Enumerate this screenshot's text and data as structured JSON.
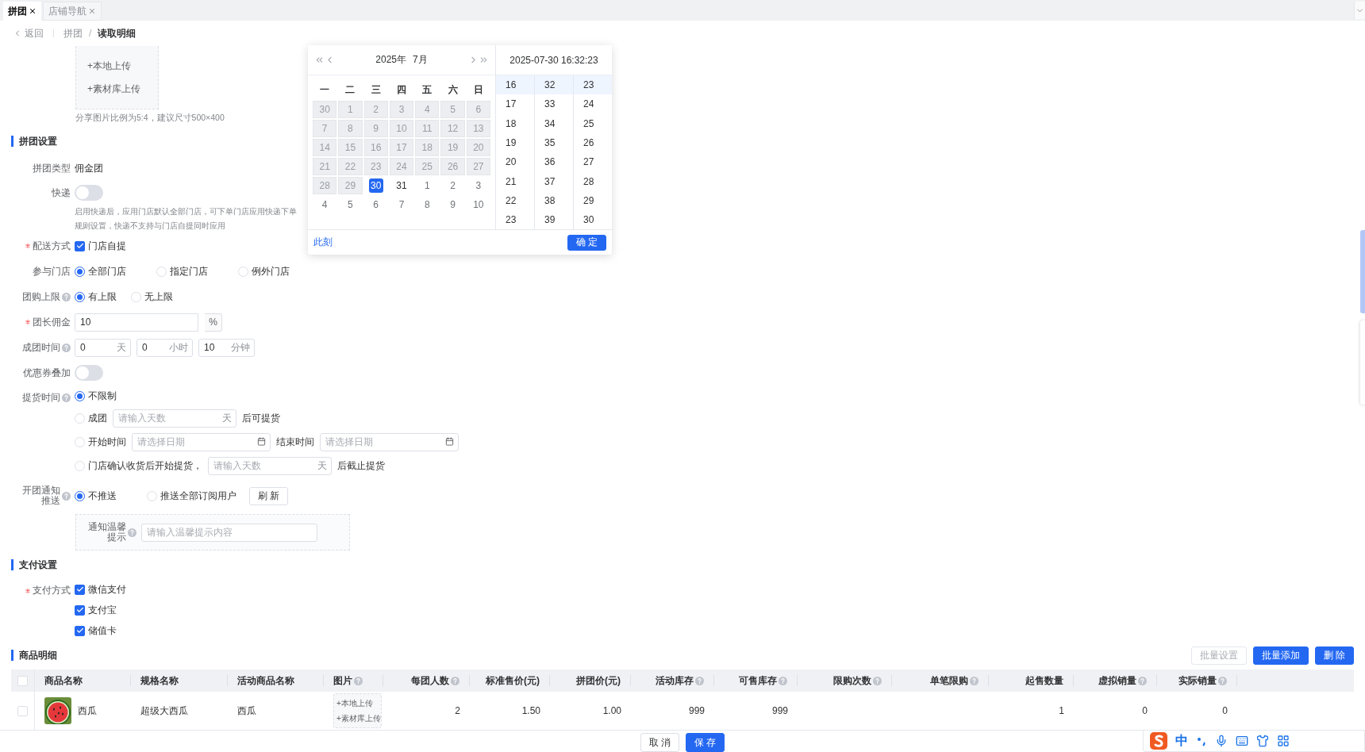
{
  "tabs": [
    {
      "label": "拼团",
      "selected": true
    },
    {
      "label": "店铺导航",
      "selected": false
    }
  ],
  "breadcrumb": {
    "back": "返回",
    "items": [
      "拼团",
      "读取明细"
    ],
    "separator": "/"
  },
  "share_image": {
    "upload_local": "+本地上传",
    "upload_library": "+素材库上传",
    "hint": "分享图片比例为5:4，建议尺寸500×400"
  },
  "group_settings": {
    "title": "拼团设置",
    "group_type": {
      "label": "拼团类型",
      "value": "佣金团"
    },
    "express": {
      "label": "快递",
      "on": false,
      "hint_lines": [
        "启用快递后，应用门店默认全部门店，可下单门店应用快递下单",
        "规则设置，快递不支持与门店自提同时应用"
      ]
    },
    "delivery": {
      "label": "配送方式",
      "required": true,
      "options": [
        {
          "label": "门店自提",
          "checked": true
        }
      ]
    },
    "stores": {
      "label": "参与门店",
      "options": [
        {
          "label": "全部门店",
          "selected": true
        },
        {
          "label": "指定门店",
          "selected": false
        },
        {
          "label": "例外门店",
          "selected": false
        }
      ]
    },
    "purchase_limit": {
      "label": "团购上限",
      "help": true,
      "options": [
        {
          "label": "有上限",
          "selected": true
        },
        {
          "label": "无上限",
          "selected": false
        }
      ]
    },
    "commission": {
      "label": "团长佣金",
      "required": true,
      "value": "10",
      "suffix": "%"
    },
    "duration": {
      "label": "成团时间",
      "help": true,
      "fields": [
        {
          "value": "0",
          "suffix": "天"
        },
        {
          "value": "0",
          "suffix": "小时"
        },
        {
          "value": "10",
          "suffix": "分钟"
        }
      ]
    },
    "coupon_stacking": {
      "label": "优惠券叠加",
      "on": false
    },
    "pickup_time": {
      "label": "提货时间",
      "help": true,
      "options": [
        {
          "kind": "plain",
          "label": "不限制",
          "selected": true
        },
        {
          "kind": "days",
          "label": "成团",
          "placeholder": "请输入天数",
          "suffix": "天",
          "after": "后可提货",
          "selected": false
        },
        {
          "kind": "range",
          "label": "开始时间",
          "placeholder": "请选择日期",
          "end_label": "结束时间",
          "end_placeholder": "请选择日期",
          "selected": false
        },
        {
          "kind": "days",
          "label": "门店确认收货后开始提货，",
          "placeholder": "请输入天数",
          "suffix": "天",
          "after": "后截止提货",
          "selected": false
        }
      ]
    },
    "notify": {
      "label": "开团通知推送",
      "help": true,
      "options": [
        {
          "label": "不推送",
          "selected": true
        },
        {
          "label": "推送全部订阅用户",
          "selected": false
        }
      ],
      "refresh": "刷 新",
      "tip": {
        "label": "通知温馨提示",
        "help": true,
        "placeholder": "请输入温馨提示内容"
      }
    }
  },
  "payment_settings": {
    "title": "支付设置",
    "label": "支付方式",
    "required": true,
    "options": [
      {
        "label": "微信支付",
        "checked": true
      },
      {
        "label": "支付宝",
        "checked": true
      },
      {
        "label": "储值卡",
        "checked": true
      }
    ]
  },
  "products": {
    "title": "商品明细",
    "all_checked": false,
    "buttons": [
      {
        "label": "批量设置",
        "disabled": true
      },
      {
        "label": "批量添加",
        "disabled": false
      },
      {
        "label": "删 除",
        "disabled": false
      }
    ],
    "columns": [
      {
        "label": "商品名称",
        "help": false
      },
      {
        "label": "规格名称",
        "help": false
      },
      {
        "label": "活动商品名称",
        "help": false
      },
      {
        "label": "图片",
        "help": true
      },
      {
        "label": "每团人数",
        "help": true
      },
      {
        "label": "标准售价(元)",
        "help": false
      },
      {
        "label": "拼团价(元)",
        "help": false
      },
      {
        "label": "活动库存",
        "help": true
      },
      {
        "label": "可售库存",
        "help": true
      },
      {
        "label": "限购次数",
        "help": true
      },
      {
        "label": "单笔限购",
        "help": true
      },
      {
        "label": "起售数量",
        "help": false
      },
      {
        "label": "虚拟销量",
        "help": true
      },
      {
        "label": "实际销量",
        "help": true
      }
    ],
    "rows": [
      {
        "checked": false,
        "name": "西瓜",
        "spec": "超级大西瓜",
        "activity_name": "西瓜",
        "upload_local": "+本地上传",
        "upload_library": "+素材库上传",
        "per_group": "2",
        "standard_price": "1.50",
        "group_price": "1.00",
        "activity_stock": "999",
        "available_stock": "999",
        "min_quantity": "1",
        "virtual_sales": "0",
        "actual_sales": "0"
      }
    ]
  },
  "footer": {
    "buttons": [
      {
        "label": "取 消",
        "primary": false
      },
      {
        "label": "保 存",
        "primary": true
      }
    ]
  },
  "date_picker": {
    "year": "2025年",
    "month": "7月",
    "datetime": "2025-07-30 16:32:23",
    "weekdays": [
      "一",
      "二",
      "三",
      "四",
      "五",
      "六",
      "日"
    ],
    "days": [
      {
        "label": "30",
        "disabled": true,
        "muted": true,
        "selected": false
      },
      {
        "label": "1",
        "disabled": true,
        "muted": true,
        "selected": false
      },
      {
        "label": "2",
        "disabled": true,
        "muted": true,
        "selected": false
      },
      {
        "label": "3",
        "disabled": true,
        "muted": true,
        "selected": false
      },
      {
        "label": "4",
        "disabled": true,
        "muted": true,
        "selected": false
      },
      {
        "label": "5",
        "disabled": true,
        "muted": true,
        "selected": false
      },
      {
        "label": "6",
        "disabled": true,
        "muted": true,
        "selected": false
      },
      {
        "label": "7",
        "disabled": true,
        "muted": true,
        "selected": false
      },
      {
        "label": "8",
        "disabled": true,
        "muted": true,
        "selected": false
      },
      {
        "label": "9",
        "disabled": true,
        "muted": true,
        "selected": false
      },
      {
        "label": "10",
        "disabled": true,
        "muted": true,
        "selected": false
      },
      {
        "label": "11",
        "disabled": true,
        "muted": true,
        "selected": false
      },
      {
        "label": "12",
        "disabled": true,
        "muted": true,
        "selected": false
      },
      {
        "label": "13",
        "disabled": true,
        "muted": true,
        "selected": false
      },
      {
        "label": "14",
        "disabled": true,
        "muted": true,
        "selected": false
      },
      {
        "label": "15",
        "disabled": true,
        "muted": true,
        "selected": false
      },
      {
        "label": "16",
        "disabled": true,
        "muted": true,
        "selected": false
      },
      {
        "label": "17",
        "disabled": true,
        "muted": true,
        "selected": false
      },
      {
        "label": "18",
        "disabled": true,
        "muted": true,
        "selected": false
      },
      {
        "label": "19",
        "disabled": true,
        "muted": true,
        "selected": false
      },
      {
        "label": "20",
        "disabled": true,
        "muted": true,
        "selected": false
      },
      {
        "label": "21",
        "disabled": true,
        "muted": true,
        "selected": false
      },
      {
        "label": "22",
        "disabled": true,
        "muted": true,
        "selected": false
      },
      {
        "label": "23",
        "disabled": true,
        "muted": true,
        "selected": false
      },
      {
        "label": "24",
        "disabled": true,
        "muted": true,
        "selected": false
      },
      {
        "label": "25",
        "disabled": true,
        "muted": true,
        "selected": false
      },
      {
        "label": "26",
        "disabled": true,
        "muted": true,
        "selected": false
      },
      {
        "label": "27",
        "disabled": true,
        "muted": true,
        "selected": false
      },
      {
        "label": "28",
        "disabled": true,
        "muted": true,
        "selected": false
      },
      {
        "label": "29",
        "disabled": true,
        "muted": true,
        "selected": false
      },
      {
        "label": "30",
        "disabled": false,
        "muted": false,
        "selected": true
      },
      {
        "label": "31",
        "disabled": false,
        "muted": false,
        "selected": false
      },
      {
        "label": "1",
        "disabled": false,
        "muted": true,
        "selected": false
      },
      {
        "label": "2",
        "disabled": false,
        "muted": true,
        "selected": false
      },
      {
        "label": "3",
        "disabled": false,
        "muted": true,
        "selected": false
      },
      {
        "label": "4",
        "disabled": false,
        "muted": true,
        "selected": false
      },
      {
        "label": "5",
        "disabled": false,
        "muted": true,
        "selected": false
      },
      {
        "label": "6",
        "disabled": false,
        "muted": true,
        "selected": false
      },
      {
        "label": "7",
        "disabled": false,
        "muted": true,
        "selected": false
      },
      {
        "label": "8",
        "disabled": false,
        "muted": true,
        "selected": false
      },
      {
        "label": "9",
        "disabled": false,
        "muted": true,
        "selected": false
      },
      {
        "label": "10",
        "disabled": false,
        "muted": true,
        "selected": false
      }
    ],
    "hours": [
      {
        "label": "16",
        "selected": true
      },
      {
        "label": "17",
        "selected": false
      },
      {
        "label": "18",
        "selected": false
      },
      {
        "label": "19",
        "selected": false
      },
      {
        "label": "20",
        "selected": false
      },
      {
        "label": "21",
        "selected": false
      },
      {
        "label": "22",
        "selected": false
      },
      {
        "label": "23",
        "selected": false
      }
    ],
    "minutes": [
      {
        "label": "32",
        "selected": true
      },
      {
        "label": "33",
        "selected": false
      },
      {
        "label": "34",
        "selected": false
      },
      {
        "label": "35",
        "selected": false
      },
      {
        "label": "36",
        "selected": false
      },
      {
        "label": "37",
        "selected": false
      },
      {
        "label": "38",
        "selected": false
      },
      {
        "label": "39",
        "selected": false
      }
    ],
    "seconds": [
      {
        "label": "23",
        "selected": true
      },
      {
        "label": "24",
        "selected": false
      },
      {
        "label": "25",
        "selected": false
      },
      {
        "label": "26",
        "selected": false
      },
      {
        "label": "27",
        "selected": false
      },
      {
        "label": "28",
        "selected": false
      },
      {
        "label": "29",
        "selected": false
      },
      {
        "label": "30",
        "selected": false
      }
    ],
    "now": "此刻",
    "confirm": "确 定"
  },
  "input_method": {
    "mode": "中"
  }
}
